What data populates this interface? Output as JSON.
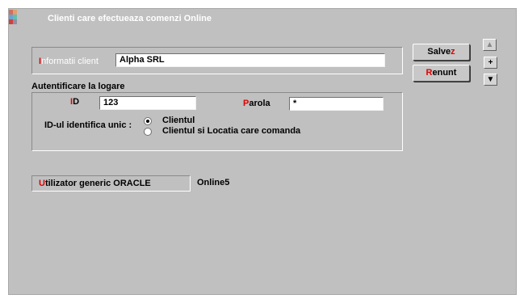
{
  "window": {
    "title": "Clienti care efectueaza comenzi Online",
    "icon": "app-logo-icon"
  },
  "client_info": {
    "label_first": "I",
    "label_rest": "nformatii client",
    "value": "Alpha SRL"
  },
  "authentication": {
    "section_label": "Autentificare la logare",
    "id_label_first": "I",
    "id_label_rest": "D",
    "id_value": "123",
    "password_label_first": "P",
    "password_label_rest": "arola",
    "password_value": "*",
    "unique_label": "ID-ul identifica unic :",
    "options": [
      "Clientul",
      "Clientul si Locatia care comanda"
    ],
    "selected_index": 0
  },
  "generic_user": {
    "label_first": "U",
    "label_rest": "tilizator generic ORACLE",
    "value": "Online5"
  },
  "buttons": {
    "save_main": "Salve",
    "save_accel": "z",
    "cancel_accel": "R",
    "cancel_rest": "enunt",
    "up_icon": "scroll-up-icon",
    "plus": "+",
    "down_icon": "scroll-down-icon"
  },
  "colors": {
    "window_bg": "#c0c0c0",
    "accelerator_red": "#e00000"
  }
}
